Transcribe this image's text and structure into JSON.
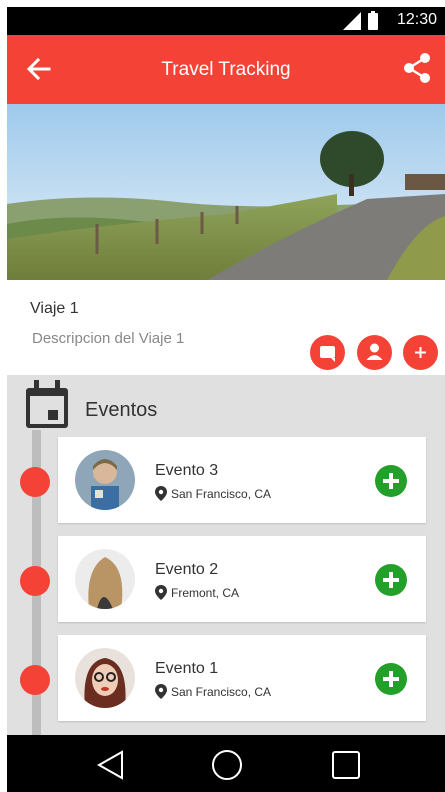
{
  "status_bar": {
    "time": "12:30"
  },
  "app_bar": {
    "title": "Travel Tracking",
    "back_icon": "arrow-back-icon",
    "share_icon": "share-icon"
  },
  "trip": {
    "name": "Viaje 1",
    "description": "Descripcion del Viaje 1",
    "actions": [
      "comment-icon",
      "person-icon",
      "add-icon"
    ]
  },
  "events": {
    "heading": "Eventos",
    "items": [
      {
        "title": "Evento 3",
        "location": "San Francisco, CA"
      },
      {
        "title": "Evento 2",
        "location": "Fremont, CA"
      },
      {
        "title": "Evento 1",
        "location": "San Francisco, CA"
      }
    ]
  },
  "colors": {
    "primary": "#f44336",
    "add_green": "#22a02a",
    "timeline_bg": "#e0e0e0"
  },
  "nav_bar": {
    "buttons": [
      "back-triangle-icon",
      "home-circle-icon",
      "recents-square-icon"
    ]
  }
}
